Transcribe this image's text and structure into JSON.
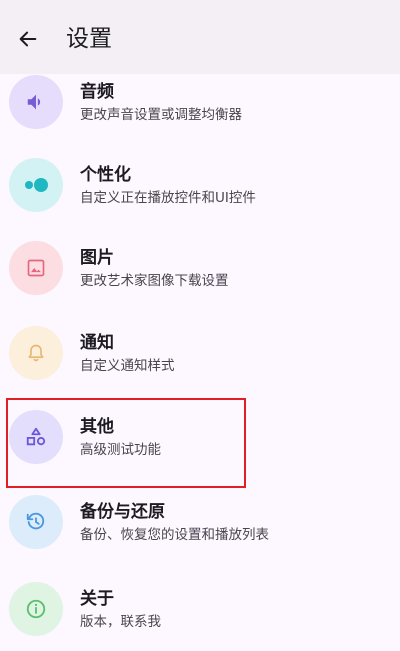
{
  "header": {
    "title": "设置"
  },
  "settings": [
    {
      "title": "音频",
      "subtitle": "更改声音设置或调整均衡器",
      "icon": "volume-icon",
      "icon_bg": "#e6dcfb",
      "icon_color": "#7a5bd6"
    },
    {
      "title": "个性化",
      "subtitle": "自定义正在播放控件和UI控件",
      "icon": "toggle-icon",
      "icon_bg": "#d3f2f3",
      "icon_color": "#1fb7c2"
    },
    {
      "title": "图片",
      "subtitle": "更改艺术家图像下载设置",
      "icon": "image-icon",
      "icon_bg": "#fbdde2",
      "icon_color": "#e5677f"
    },
    {
      "title": "通知",
      "subtitle": "自定义通知样式",
      "icon": "bell-icon",
      "icon_bg": "#fcefdc",
      "icon_color": "#e9b86f"
    },
    {
      "title": "其他",
      "subtitle": "高级测试功能",
      "icon": "shapes-icon",
      "icon_bg": "#e3defc",
      "icon_color": "#6b57d8"
    },
    {
      "title": "备份与还原",
      "subtitle": "备份、恢复您的设置和播放列表",
      "icon": "restore-icon",
      "icon_bg": "#dcecfa",
      "icon_color": "#4a98e0"
    },
    {
      "title": "关于",
      "subtitle": "版本，联系我",
      "icon": "info-icon",
      "icon_bg": "#dff4e3",
      "icon_color": "#5cbf6e"
    }
  ],
  "highlight_color": "#e01f26"
}
